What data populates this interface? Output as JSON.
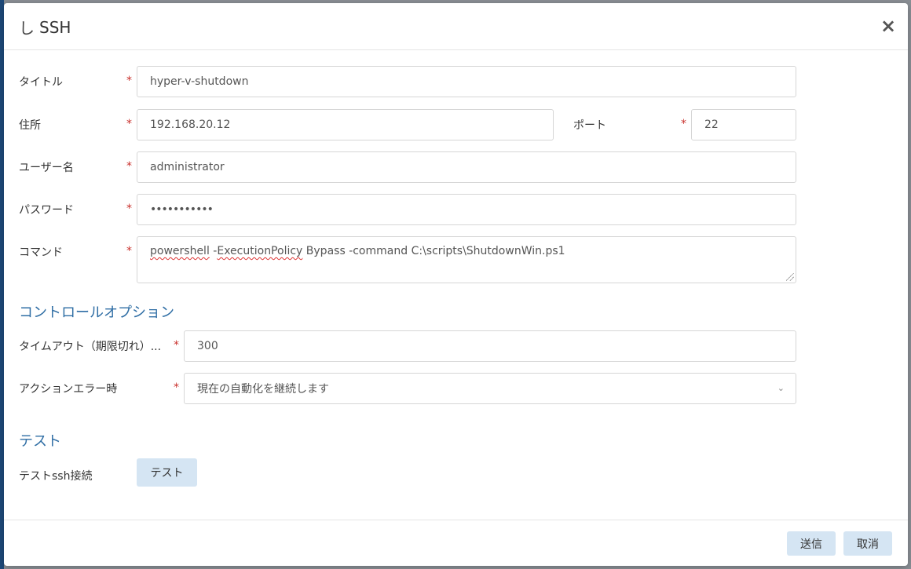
{
  "dialog": {
    "title": "SSH",
    "title_icon": "power-icon",
    "close_glyph": "×"
  },
  "form": {
    "required_mark": "*",
    "title": {
      "label": "タイトル",
      "value": "hyper-v-shutdown"
    },
    "address": {
      "label": "住所",
      "value": "192.168.20.12"
    },
    "port": {
      "label": "ポート",
      "value": "22"
    },
    "username": {
      "label": "ユーザー名",
      "value": "administrator"
    },
    "password": {
      "label": "パスワード",
      "value": "•••••••••••"
    },
    "command": {
      "label": "コマンド",
      "value_part1": "powershell",
      "value_part2": " -",
      "value_part3": "ExecutionPolicy",
      "value_part4": " Bypass -command C:\\scripts\\ShutdownWin.ps1"
    }
  },
  "control_options": {
    "section_title": "コントロールオプション",
    "timeout": {
      "label": "タイムアウト（期限切れ）...",
      "value": "300"
    },
    "on_error": {
      "label": "アクションエラー時",
      "value": "現在の自動化を継続します"
    }
  },
  "test": {
    "section_title": "テスト",
    "label": "テストssh接続",
    "button_label": "テスト"
  },
  "footer": {
    "submit_label": "送信",
    "cancel_label": "取消"
  },
  "colors": {
    "accent": "#2e6da4",
    "required": "#c9302c",
    "button_bg": "#d5e5f3"
  }
}
